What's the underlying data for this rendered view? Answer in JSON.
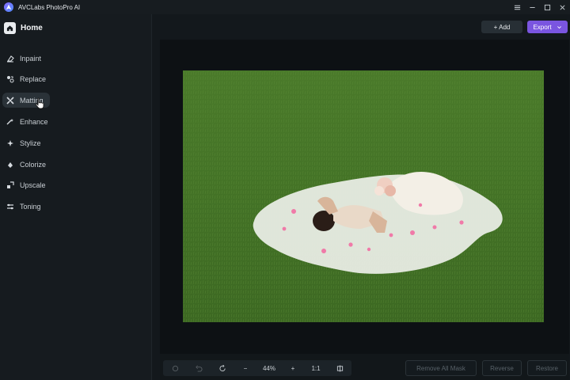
{
  "app": {
    "title": "AVCLabs PhotoPro AI"
  },
  "sidebar": {
    "home_label": "Home",
    "items": [
      {
        "label": "Inpaint",
        "icon": "eraser-icon"
      },
      {
        "label": "Replace",
        "icon": "replace-icon"
      },
      {
        "label": "Matting",
        "icon": "matting-icon",
        "active": true
      },
      {
        "label": "Enhance",
        "icon": "enhance-icon"
      },
      {
        "label": "Stylize",
        "icon": "stylize-icon"
      },
      {
        "label": "Colorize",
        "icon": "colorize-icon"
      },
      {
        "label": "Upscale",
        "icon": "upscale-icon"
      },
      {
        "label": "Toning",
        "icon": "toning-icon"
      }
    ]
  },
  "toolbar": {
    "add_label": "+ Add",
    "export_label": "Export"
  },
  "bottom": {
    "zoom_out_label": "−",
    "zoom_level": "44%",
    "zoom_in_label": "+",
    "actual_size_label": "1:1",
    "remove_all_mask_label": "Remove All Mask",
    "reverse_label": "Reverse",
    "restore_label": "Restore"
  },
  "colors": {
    "accent": "#7a55e0",
    "background": "#13181c",
    "grass": "#4a7a2a"
  }
}
